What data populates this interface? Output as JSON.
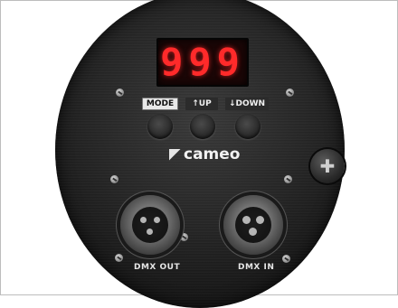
{
  "display": {
    "value": "999"
  },
  "buttons": {
    "mode_label": "MODE",
    "up_label": "↑UP",
    "down_label": "↓DOWN"
  },
  "brand": {
    "name": "cameo"
  },
  "connectors": {
    "out_label": "DMX OUT",
    "in_label": "DMX IN"
  },
  "colors": {
    "display_red": "#ff2a2a",
    "panel": "#262626",
    "label_plate": "#e8e8e8"
  },
  "icons": {
    "screw": "screw-icon",
    "xlr_female": "xlr-female-socket",
    "xlr_male": "xlr-male-socket",
    "knob": "thumb-screw-icon"
  }
}
